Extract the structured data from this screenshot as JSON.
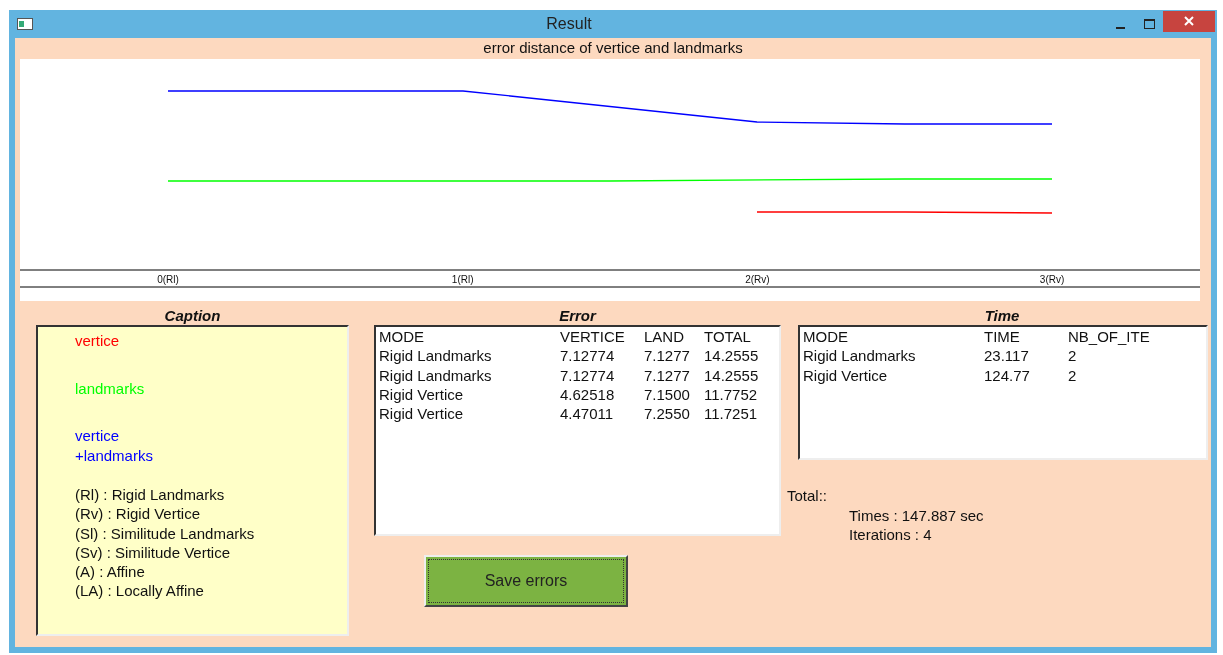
{
  "window": {
    "title": "Result"
  },
  "chart": {
    "title": "error distance of vertice and landmarks",
    "x_labels": [
      "0(Rl)",
      "1(Rl)",
      "2(Rv)",
      "3(Rv)"
    ]
  },
  "caption": {
    "title": "Caption",
    "series": [
      {
        "lines": [
          "vertice"
        ],
        "color": "#ff0000"
      },
      {
        "lines": [
          "landmarks"
        ],
        "color": "#00ff00"
      },
      {
        "lines": [
          "vertice",
          "+landmarks"
        ],
        "color": "#0000ff"
      }
    ],
    "legend": [
      "(Rl) : Rigid Landmarks",
      "(Rv) : Rigid Vertice",
      "(Sl) : Similitude Landmarks",
      "(Sv) : Similitude Vertice",
      "(A) : Affine",
      "(LA) : Locally Affine"
    ]
  },
  "error": {
    "title": "Error",
    "columns": [
      "MODE",
      "VERTICE",
      "LAND",
      "TOTAL"
    ],
    "rows": [
      [
        "Rigid Landmarks",
        "7.12774",
        "7.1277",
        "14.2555"
      ],
      [
        "Rigid Landmarks",
        "7.12774",
        "7.1277",
        "14.2555"
      ],
      [
        "Rigid Vertice",
        "4.62518",
        "7.1500",
        "11.7752"
      ],
      [
        "Rigid Vertice",
        "4.47011",
        "7.2550",
        "11.7251"
      ]
    ]
  },
  "save_button": {
    "label": "Save errors"
  },
  "time": {
    "title": "Time",
    "columns": [
      "MODE",
      "TIME",
      "NB_OF_ITE"
    ],
    "rows": [
      [
        "Rigid Landmarks",
        "23.117",
        "2"
      ],
      [
        "Rigid Vertice",
        "124.77",
        "2"
      ]
    ]
  },
  "total": {
    "label": "Total::",
    "lines": [
      "Times : 147.887 sec",
      "Iterations : 4"
    ]
  }
}
